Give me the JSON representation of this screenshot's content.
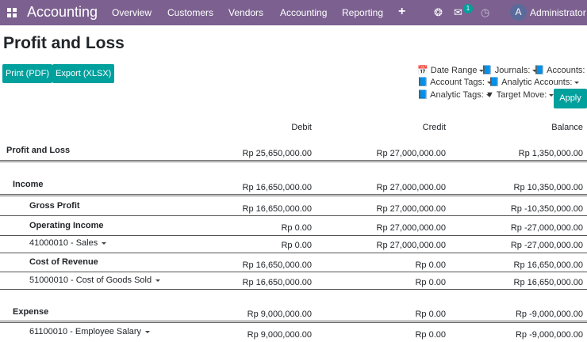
{
  "app": {
    "brand": "Accounting",
    "menu": [
      "Overview",
      "Customers",
      "Vendors",
      "Accounting",
      "Reporting"
    ],
    "plus": "+",
    "notif_count": "1",
    "avatar_letter": "A",
    "user": "Administrator (c"
  },
  "page": {
    "title": "Profit and Loss",
    "print_label": "Print (PDF)",
    "export_label": "Export (XLSX)",
    "apply_label": "Apply"
  },
  "filters": {
    "date_range": "Date Range",
    "journals": "Journals:",
    "accounts": "Accounts:",
    "account_tags": "Account Tags:",
    "analytic_accounts": "Analytic Accounts:",
    "analytic_tags": "Analytic Tags:",
    "target_move": "Target Move:"
  },
  "columns": {
    "debit": "Debit",
    "credit": "Credit",
    "balance": "Balance"
  },
  "rows": [
    {
      "label": "Profit and Loss",
      "debit": "Rp 25,650,000.00",
      "credit": "Rp 27,000,000.00",
      "balance": "Rp 1,350,000.00"
    },
    {
      "label": "Income",
      "debit": "Rp 16,650,000.00",
      "credit": "Rp 27,000,000.00",
      "balance": "Rp 10,350,000.00"
    },
    {
      "label": "Gross Profit",
      "debit": "Rp 16,650,000.00",
      "credit": "Rp 27,000,000.00",
      "balance": "Rp -10,350,000.00"
    },
    {
      "label": "Operating Income",
      "debit": "Rp 0.00",
      "credit": "Rp 27,000,000.00",
      "balance": "Rp -27,000,000.00"
    },
    {
      "label": "41000010 - Sales",
      "debit": "Rp 0.00",
      "credit": "Rp 27,000,000.00",
      "balance": "Rp -27,000,000.00"
    },
    {
      "label": "Cost of Revenue",
      "debit": "Rp 16,650,000.00",
      "credit": "Rp 0.00",
      "balance": "Rp 16,650,000.00"
    },
    {
      "label": "51000010 - Cost of Goods Sold",
      "debit": "Rp 16,650,000.00",
      "credit": "Rp 0.00",
      "balance": "Rp 16,650,000.00"
    },
    {
      "label": "Expense",
      "debit": "Rp 9,000,000.00",
      "credit": "Rp 0.00",
      "balance": "Rp -9,000,000.00"
    },
    {
      "label": "61100010 - Employee Salary",
      "debit": "Rp 9,000,000.00",
      "credit": "Rp 0.00",
      "balance": "Rp -9,000,000.00"
    }
  ]
}
